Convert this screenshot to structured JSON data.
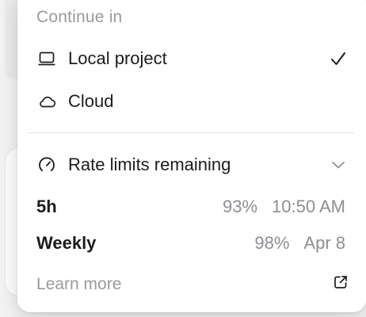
{
  "menu": {
    "section_header": "Continue in",
    "options": [
      {
        "label": "Local project",
        "icon": "laptop-icon",
        "selected": true
      },
      {
        "label": "Cloud",
        "icon": "cloud-icon",
        "selected": false
      }
    ],
    "rate_limits": {
      "label": "Rate limits remaining",
      "icon": "gauge-icon",
      "expanded": true,
      "rows": [
        {
          "label": "5h",
          "percent": "93%",
          "reset": "10:50 AM"
        },
        {
          "label": "Weekly",
          "percent": "98%",
          "reset": "Apr 8"
        }
      ]
    },
    "learn_more": {
      "label": "Learn more",
      "icon": "external-link-icon"
    }
  },
  "colors": {
    "text_primary": "#1c1c1e",
    "text_secondary": "#8e8e93",
    "divider": "#e3e3e6",
    "menu_bg": "#ffffff"
  }
}
